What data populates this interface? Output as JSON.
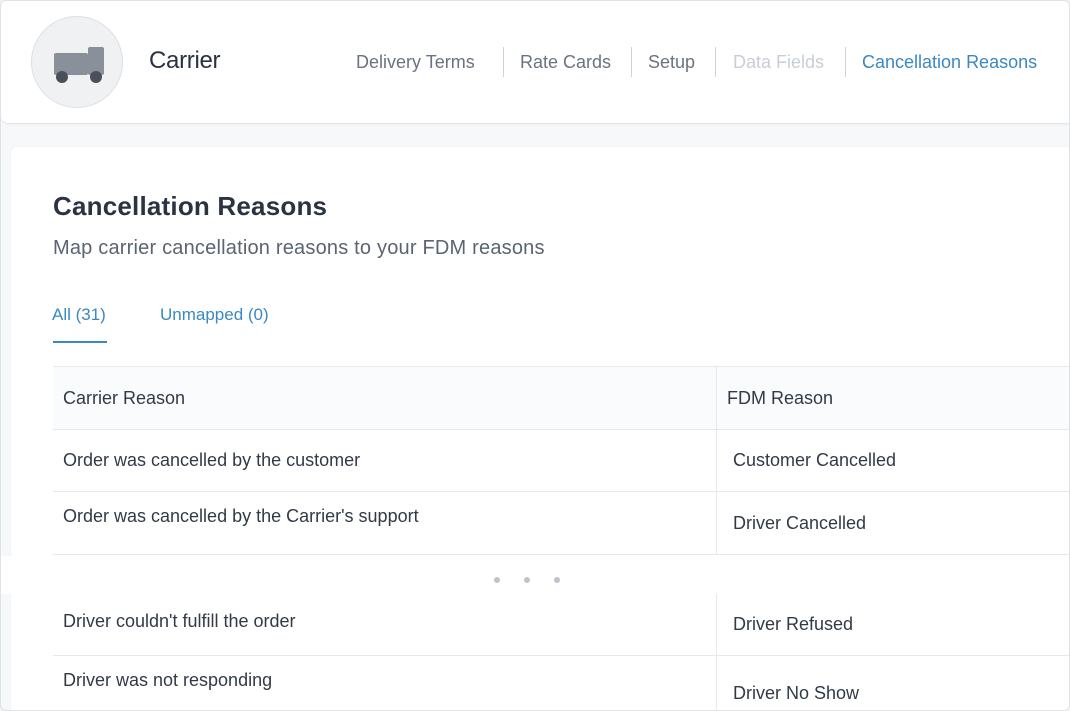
{
  "header": {
    "carrier_name": "Carrier",
    "avatar_icon": "truck-icon",
    "nav": [
      {
        "label": "Delivery Terms",
        "state": "normal"
      },
      {
        "label": "Rate Cards",
        "state": "normal"
      },
      {
        "label": "Setup",
        "state": "normal"
      },
      {
        "label": "Data Fields",
        "state": "disabled"
      },
      {
        "label": "Cancellation Reasons",
        "state": "active"
      }
    ]
  },
  "page": {
    "title": "Cancellation Reasons",
    "subtitle": "Map carrier cancellation reasons to your FDM reasons",
    "tabs": [
      {
        "label": "All (31)",
        "active": true
      },
      {
        "label": "Unmapped (0)",
        "active": false
      }
    ]
  },
  "table": {
    "columns": [
      "Carrier Reason",
      "FDM Reason"
    ],
    "rows_top": [
      {
        "carrier": "Order was cancelled by the customer",
        "fdm": "Customer Cancelled"
      },
      {
        "carrier": "Order was cancelled by the Carrier's support",
        "fdm": "Driver Cancelled"
      }
    ],
    "rows_bottom": [
      {
        "carrier": "Driver couldn't fulfill the order",
        "fdm": "Driver Refused"
      },
      {
        "carrier": "Driver was not responding",
        "fdm": "Driver No Show"
      }
    ]
  },
  "colors": {
    "accent": "#3b88c3",
    "text": "#2b3342",
    "muted": "#6b7280",
    "disabled": "#c9ced6"
  }
}
